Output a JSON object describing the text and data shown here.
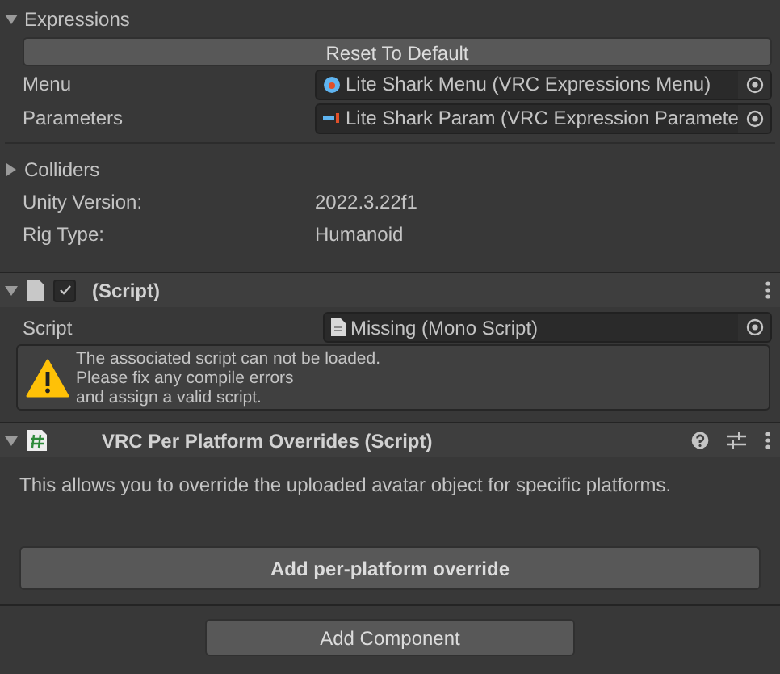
{
  "expressions": {
    "label": "Expressions",
    "expanded": true,
    "reset_button": "Reset To Default",
    "fields": [
      {
        "label": "Menu",
        "value": "Lite Shark Menu (VRC Expressions Menu)",
        "kind": "menu"
      },
      {
        "label": "Parameters",
        "value": "Lite Shark Param (VRC Expression Paramete",
        "kind": "param"
      }
    ]
  },
  "colliders": {
    "label": "Colliders",
    "expanded": false
  },
  "info": [
    {
      "label": "Unity Version:",
      "value": "2022.3.22f1"
    },
    {
      "label": "Rig Type:",
      "value": "Humanoid"
    }
  ],
  "script_component": {
    "title": "(Script)",
    "expanded": true,
    "enabled": true,
    "field_label": "Script",
    "field_value": "Missing (Mono Script)",
    "warning": "The associated script can not be loaded.\nPlease fix any compile errors\nand assign a valid script."
  },
  "overrides_component": {
    "title": "VRC Per Platform Overrides (Script)",
    "expanded": true,
    "description": "This allows you to override the uploaded avatar object for specific platforms.",
    "button": "Add per-platform override"
  },
  "add_component_button": "Add Component"
}
